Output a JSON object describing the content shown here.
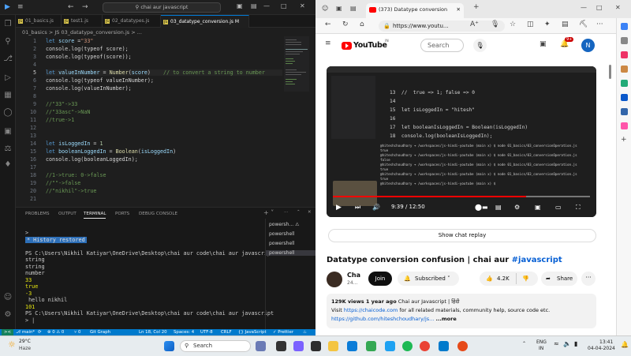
{
  "vscode": {
    "search": "chai aur javascript",
    "tabs": [
      {
        "label": "01_basics.js"
      },
      {
        "label": "test1.js"
      },
      {
        "label": "02_datatypes.js"
      },
      {
        "label": "03_datatype_conversion.js M"
      }
    ],
    "breadcrumb": "01_basics > JS 03_datatype_conversion.js > ...",
    "code_lines": [
      {
        "n": "1"
      },
      {
        "n": "2"
      },
      {
        "n": "3"
      },
      {
        "n": "4"
      },
      {
        "n": "5"
      },
      {
        "n": "6"
      },
      {
        "n": "7"
      },
      {
        "n": "8"
      },
      {
        "n": "9"
      },
      {
        "n": "10"
      },
      {
        "n": "11"
      },
      {
        "n": "12"
      },
      {
        "n": "13"
      },
      {
        "n": "14"
      },
      {
        "n": "15"
      },
      {
        "n": "16"
      },
      {
        "n": "17"
      },
      {
        "n": "18"
      },
      {
        "n": "19"
      },
      {
        "n": "20"
      },
      {
        "n": "21"
      }
    ],
    "code": {
      "l1": "let score =\"33\"",
      "l2": "console.log(typeof score);",
      "l3": "console.log(typeof(score));",
      "l5": "let valueInNumber = Number(score)    // to convert a string to number",
      "l6": "console.log(typeof valueInNumber);",
      "l7": "console.log(valueInNumber);",
      "l9": "//\"33\"->33",
      "l10": "//\"33asc\"->NaN",
      "l11": "//true->1",
      "l13": "let isLoggedIn = 1",
      "l14": "let booleanLoggedIn = Boolean(isLoggedIn)",
      "l15": "console.log(booleanLoggedIn);",
      "l17": "//1->true: 0->false",
      "l18": "//\"\"->false",
      "l19": "//\"nikhil\"->true"
    },
    "panel_tabs": [
      "PROBLEMS",
      "OUTPUT",
      "TERMINAL",
      "PORTS",
      "DEBUG CONSOLE"
    ],
    "terminal": {
      "prompt": ">",
      "history": "* History restored",
      "cmd": "PS C:\\Users\\Nikhil Katiyar\\OneDrive\\Desktop\\chai aur code\\chai aur javascript",
      "out1": "string",
      "out2": "string",
      "out3": "number",
      "out4": "33",
      "out5": "true",
      "out6": "-3",
      "out7": " hello nikhil",
      "out8": "101",
      "cmd2": "PS C:\\Users\\Nikhil Katiyar\\OneDrive\\Desktop\\chai aur code\\chai aur javascript",
      "prompt2": "> |"
    },
    "terminals": [
      "powersh... ⚠",
      "powershell",
      "powershell",
      "powershell"
    ],
    "status": {
      "branch": "⎇ main*",
      "sync": "⟳",
      "errors": "⊗ 0 ⚠ 0",
      "ports": "⑂ 0",
      "git": "Git Graph",
      "pos": "Ln 18, Col 20",
      "spaces": "Spaces: 4",
      "enc": "UTF-8",
      "eol": "CRLF",
      "lang": "{} JavaScript",
      "prettier": "✓ Prettier"
    }
  },
  "browser": {
    "tab_title": "(373) Datatype conversion conf...",
    "url": "https://www.youtu...",
    "notif_count": "9+",
    "yt_logo": "YouTube",
    "yt_region": "IN",
    "search_placeholder": "Search",
    "avatar": "N",
    "video": {
      "code": {
        "l13": "13  //  true => 1; false => 0",
        "l14": "14",
        "l15": "15  let isLoggedIn = \"hitesh\"",
        "l16": "16",
        "l17": "17  let booleanIsLoggedIn = Boolean(isLoggedIn)",
        "l18": "18  console.log(booleanIsLoggedIn);"
      },
      "time": "9:39 / 12:50",
      "progress": 0.75
    },
    "chat_replay": "Show chat replay",
    "title_main": "Datatype conversion confusion | chai aur ",
    "title_tag": "#javascript",
    "channel": "Cha",
    "subs": "24...",
    "join": "Join",
    "subscribed": "Subscribed",
    "likes": "4.2K",
    "share": "Share",
    "desc_stats": "129K views  1 year ago",
    "desc_channel": "Chai aur Javascript | हिंदी",
    "desc_line2": "Visit ",
    "desc_link1": "https://chaicode.com",
    "desc_line2b": " for all related materials, community help, source code etc.",
    "desc_link2": "https://github.com/hiteshchoudhary/js...",
    "desc_more": "...more"
  },
  "taskbar": {
    "weather_temp": "29°C",
    "weather_desc": "Haze",
    "search": "Search",
    "lang": "ENG",
    "region": "IN",
    "time": "13:41",
    "date": "04-04-2024"
  }
}
